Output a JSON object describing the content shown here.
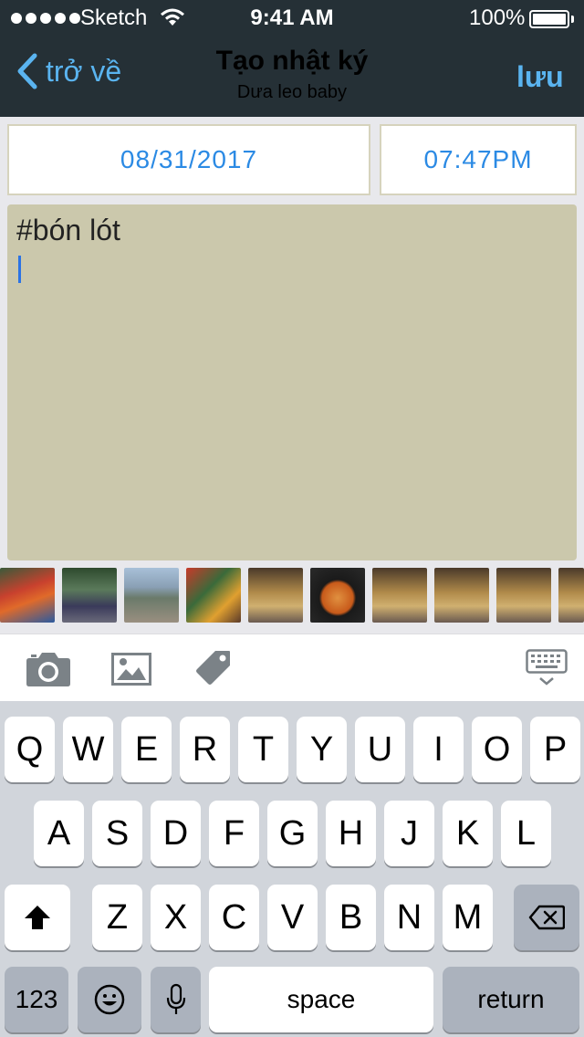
{
  "status_bar": {
    "carrier": "Sketch",
    "time": "9:41 AM",
    "battery": "100%"
  },
  "nav": {
    "back_label": "trở về",
    "title": "Tạo nhật ký",
    "subtitle": "Dưa leo baby",
    "save_label": "lưu"
  },
  "entry": {
    "date": "08/31/2017",
    "time": "07:47PM",
    "text": "#bón lót"
  },
  "photos": [
    {
      "name": "photo-berries",
      "icon": "berries-photo"
    },
    {
      "name": "photo-picnic",
      "icon": "picnic-photo"
    },
    {
      "name": "photo-mountain",
      "icon": "mountain-photo"
    },
    {
      "name": "photo-market",
      "icon": "market-photo"
    },
    {
      "name": "photo-popcorn-1",
      "icon": "popcorn-photo"
    },
    {
      "name": "photo-soup",
      "icon": "soup-photo"
    },
    {
      "name": "photo-popcorn-2",
      "icon": "popcorn-photo"
    },
    {
      "name": "photo-popcorn-3",
      "icon": "popcorn-photo"
    },
    {
      "name": "photo-popcorn-4",
      "icon": "popcorn-photo"
    },
    {
      "name": "photo-popcorn-5",
      "icon": "popcorn-photo"
    }
  ],
  "toolbar": {
    "icons": [
      "camera-icon",
      "image-icon",
      "tag-icon",
      "keyboard-dismiss-icon"
    ]
  },
  "keyboard": {
    "row1": [
      "Q",
      "W",
      "E",
      "R",
      "T",
      "Y",
      "U",
      "I",
      "O",
      "P"
    ],
    "row2": [
      "A",
      "S",
      "D",
      "F",
      "G",
      "H",
      "J",
      "K",
      "L"
    ],
    "row3": [
      "Z",
      "X",
      "C",
      "V",
      "B",
      "N",
      "M"
    ],
    "numbers_label": "123",
    "space_label": "space",
    "return_label": "return"
  }
}
